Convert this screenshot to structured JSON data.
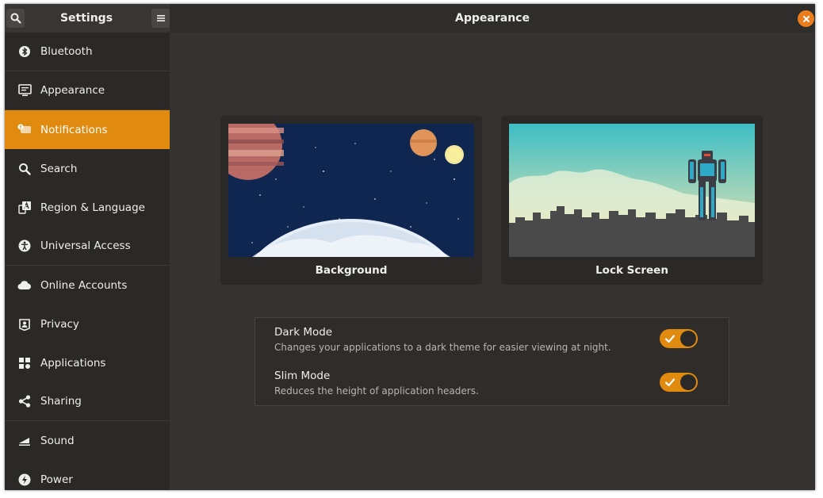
{
  "header": {
    "sidebar_title": "Settings",
    "page_title": "Appearance"
  },
  "colors": {
    "accent": "#e08b0f",
    "close": "#ec7d1c",
    "sidebar_bg": "#2b2927",
    "main_bg": "#353230"
  },
  "sidebar": {
    "items": [
      {
        "label": "Bluetooth",
        "icon": "bluetooth-icon"
      },
      {
        "label": "Appearance",
        "icon": "monitor-icon"
      },
      {
        "label": "Notifications",
        "icon": "notification-icon",
        "active": true
      },
      {
        "label": "Search",
        "icon": "search-icon"
      },
      {
        "label": "Region & Language",
        "icon": "language-icon"
      },
      {
        "label": "Universal Access",
        "icon": "accessibility-icon"
      },
      {
        "label": "Online Accounts",
        "icon": "cloud-icon"
      },
      {
        "label": "Privacy",
        "icon": "privacy-icon"
      },
      {
        "label": "Applications",
        "icon": "applications-icon"
      },
      {
        "label": "Sharing",
        "icon": "share-icon"
      },
      {
        "label": "Sound",
        "icon": "sound-icon"
      },
      {
        "label": "Power",
        "icon": "power-icon"
      }
    ]
  },
  "cards": {
    "background_label": "Background",
    "lockscreen_label": "Lock Screen"
  },
  "modes": {
    "dark": {
      "title": "Dark Mode",
      "subtitle": "Changes your applications to a dark theme for easier viewing at night.",
      "enabled": true
    },
    "slim": {
      "title": "Slim Mode",
      "subtitle": "Reduces the height of application headers.",
      "enabled": true
    }
  }
}
